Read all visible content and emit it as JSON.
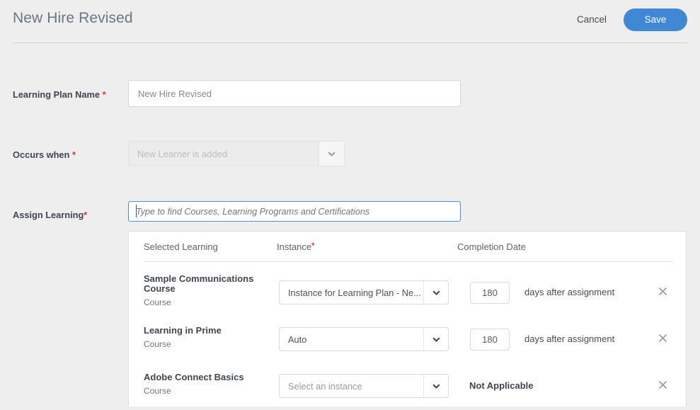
{
  "header": {
    "title": "New Hire Revised",
    "cancel_label": "Cancel",
    "save_label": "Save",
    "accent_color": "#4087d6"
  },
  "form": {
    "learning_plan_name": {
      "label": "Learning Plan Name",
      "required_marker": "*",
      "value": "New Hire Revised"
    },
    "occurs_when": {
      "label": "Occurs when",
      "required_marker": "*",
      "value": "New Learner is added"
    },
    "assign_learning": {
      "label": "Assign Learning",
      "required_marker": "*",
      "placeholder": "Type to find Courses, Learning Programs and Certifications"
    }
  },
  "learning_table": {
    "columns": {
      "selected_learning": "Selected Learning",
      "instance": "Instance",
      "instance_required_marker": "*",
      "completion_date": "Completion Date"
    },
    "rows": [
      {
        "title": "Sample Communications Course",
        "type": "Course",
        "instance": "Instance for Learning Plan - Ne...",
        "instance_is_placeholder": false,
        "completion_mode": "days",
        "days": "180",
        "days_suffix": "days after assignment",
        "remove_label": "×"
      },
      {
        "title": "Learning in Prime",
        "type": "Course",
        "instance": "Auto",
        "instance_is_placeholder": false,
        "completion_mode": "days",
        "days": "180",
        "days_suffix": "days after assignment",
        "remove_label": "×"
      },
      {
        "title": "Adobe Connect Basics",
        "type": "Course",
        "instance": "Select an instance",
        "instance_is_placeholder": true,
        "completion_mode": "not_applicable",
        "not_applicable_label": "Not Applicable",
        "remove_label": "×"
      }
    ]
  }
}
